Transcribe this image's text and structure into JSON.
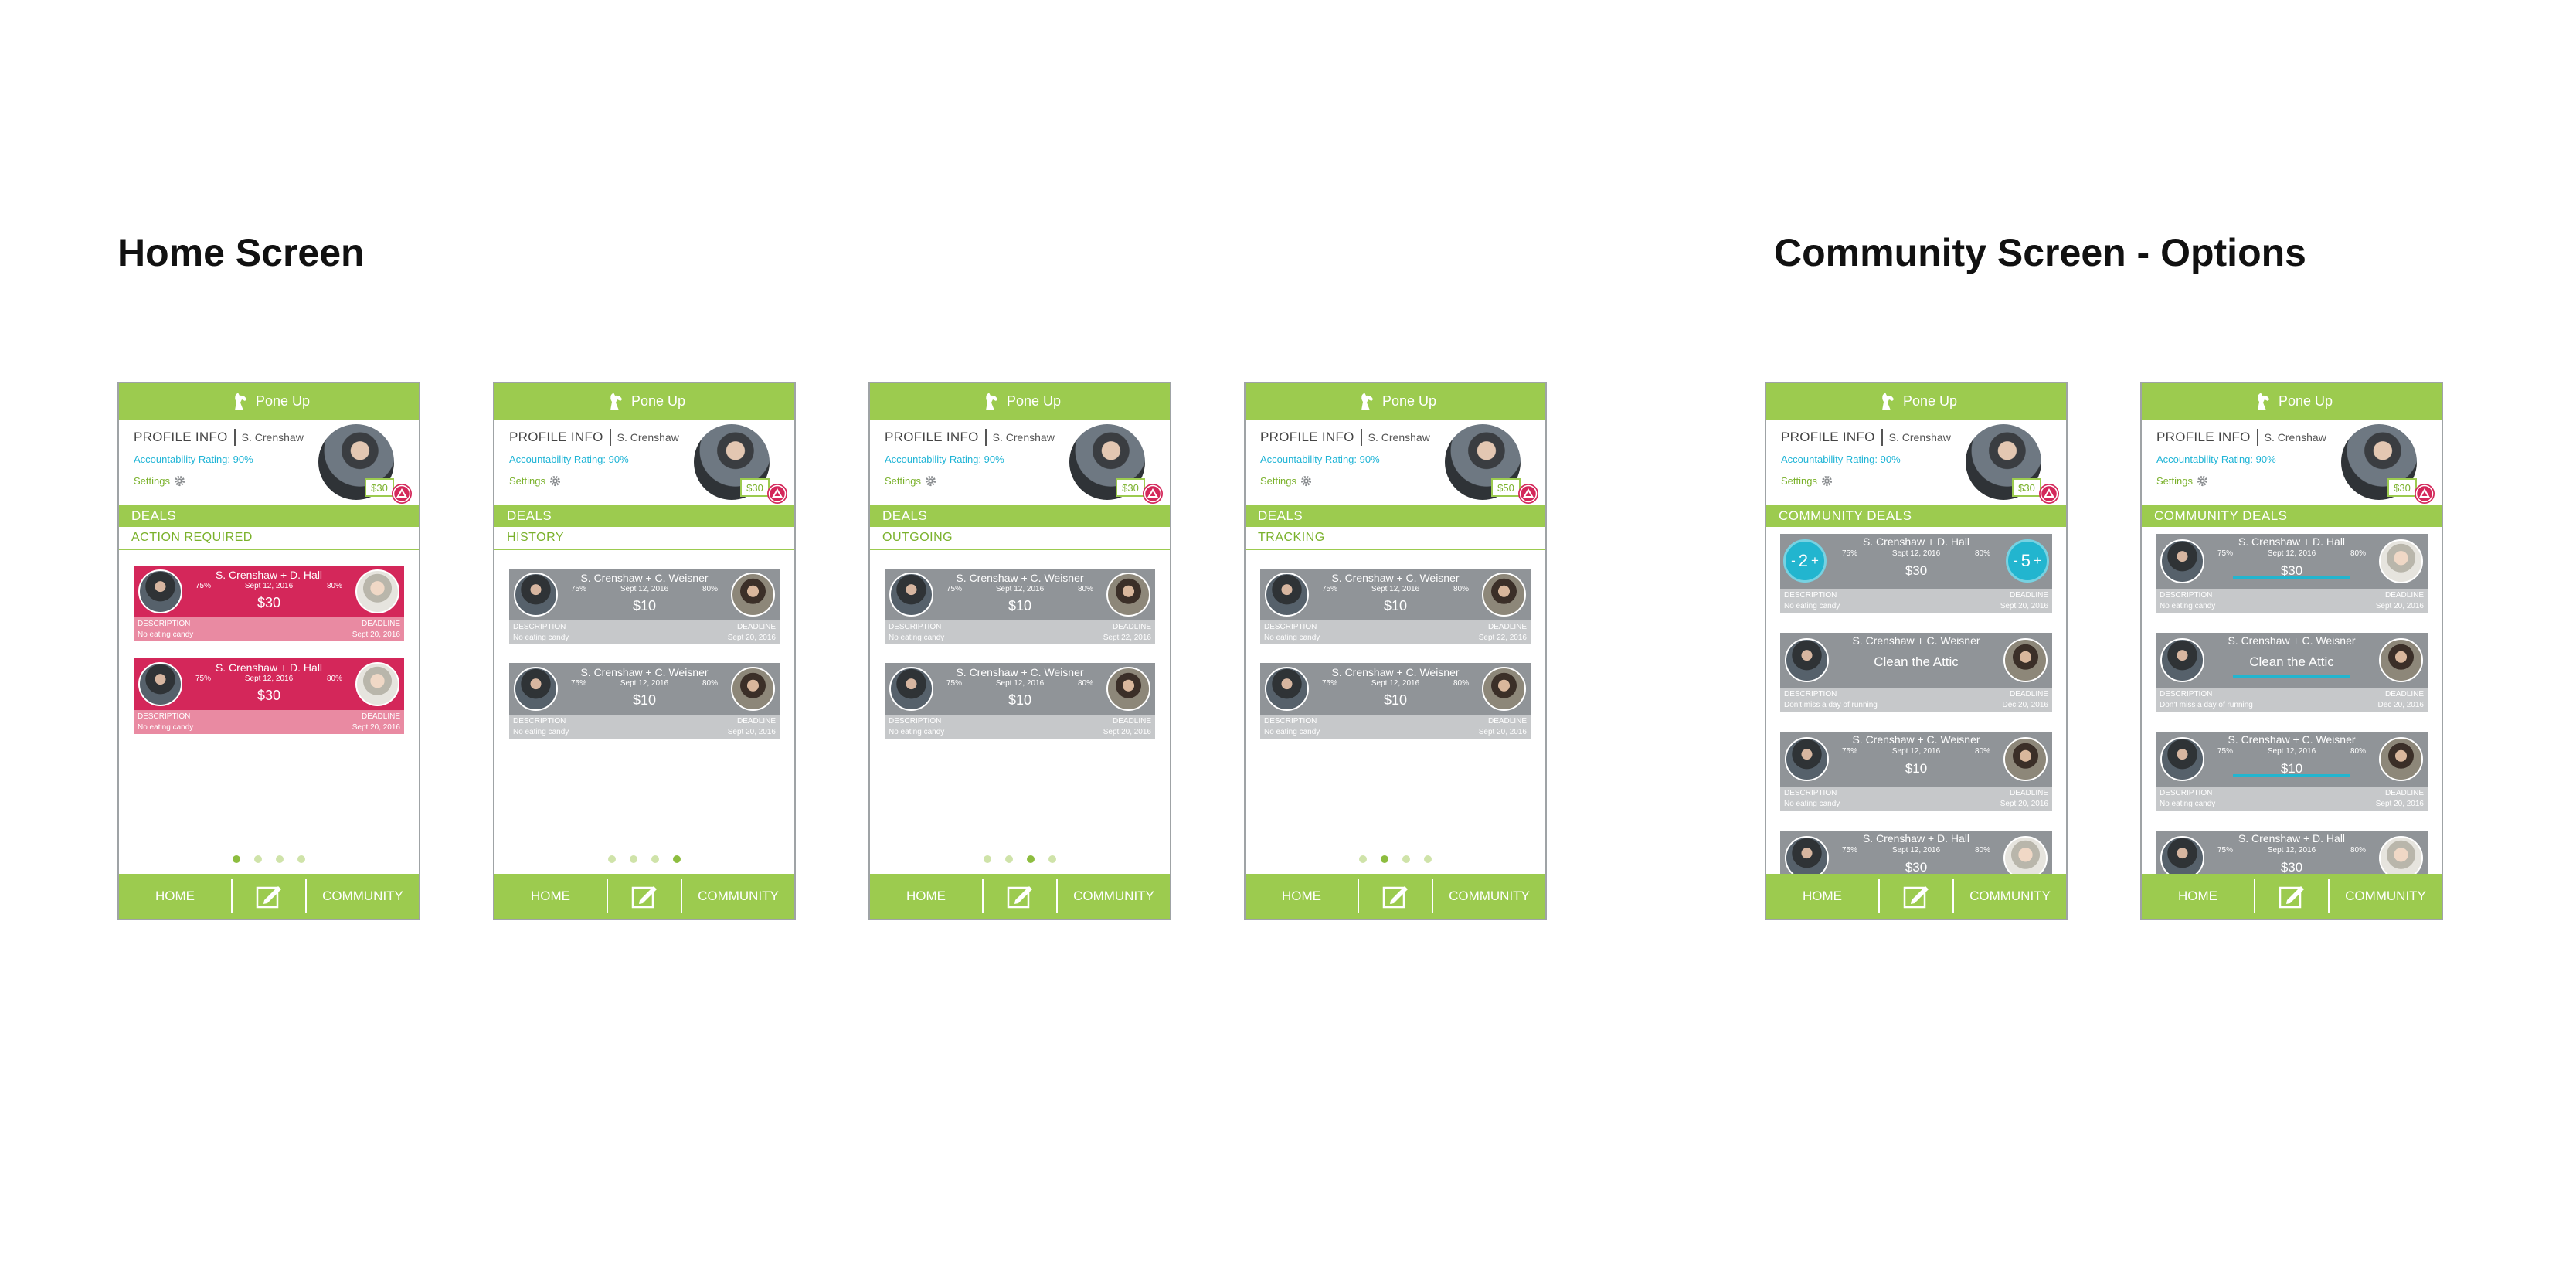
{
  "sections": {
    "home_title": "Home Screen",
    "community_title": "Community Screen - Options"
  },
  "app": {
    "name": "Pone Up",
    "profile_label": "PROFILE INFO",
    "user_name": "S. Crenshaw",
    "rating": "Accountability Rating: 90%",
    "settings": "Settings",
    "wallet": "$30",
    "deals": "DEALS",
    "community_deals": "COMMUNITY DEALS",
    "nav": {
      "home": "HOME",
      "community": "COMMUNITY"
    },
    "desc_label": "DESCRIPTION",
    "deadline_label": "DEADLINE"
  },
  "home_screens": [
    {
      "subheader": "ACTION REQUIRED",
      "theme": "red",
      "active_dot": 0,
      "cards": [
        {
          "names": "S. Crenshaw + D. Hall",
          "pct_a": "75%",
          "date": "Sept 12, 2016",
          "pct_b": "80%",
          "amount": "$30",
          "description": "No eating candy",
          "deadline": "Sept 20, 2016"
        },
        {
          "names": "S. Crenshaw + D. Hall",
          "pct_a": "75%",
          "date": "Sept 12, 2016",
          "pct_b": "80%",
          "amount": "$30",
          "description": "No eating candy",
          "deadline": "Sept 20, 2016"
        }
      ]
    },
    {
      "subheader": "HISTORY",
      "theme": "gray",
      "active_dot": 3,
      "cards": [
        {
          "names": "S. Crenshaw + C. Weisner",
          "pct_a": "75%",
          "date": "Sept 12, 2016",
          "pct_b": "80%",
          "amount": "$10",
          "description": "No eating candy",
          "deadline": "Sept 20, 2016"
        },
        {
          "names": "S. Crenshaw + C. Weisner",
          "pct_a": "75%",
          "date": "Sept 12, 2016",
          "pct_b": "80%",
          "amount": "$10",
          "description": "No eating candy",
          "deadline": "Sept 20, 2016"
        }
      ]
    },
    {
      "subheader": "OUTGOING",
      "theme": "gray",
      "active_dot": 2,
      "cards": [
        {
          "names": "S. Crenshaw + C. Weisner",
          "pct_a": "75%",
          "date": "Sept 12, 2016",
          "pct_b": "80%",
          "amount": "$10",
          "description": "No eating candy",
          "deadline": "Sept 22, 2016"
        },
        {
          "names": "S. Crenshaw + C. Weisner",
          "pct_a": "75%",
          "date": "Sept 12, 2016",
          "pct_b": "80%",
          "amount": "$10",
          "description": "No eating candy",
          "deadline": "Sept 20, 2016"
        }
      ]
    },
    {
      "subheader": "TRACKING",
      "theme": "gray",
      "active_dot": 1,
      "wallet": "$50",
      "cards": [
        {
          "names": "S. Crenshaw + C. Weisner",
          "pct_a": "75%",
          "date": "Sept 12, 2016",
          "pct_b": "80%",
          "amount": "$10",
          "description": "No eating candy",
          "deadline": "Sept 22, 2016"
        },
        {
          "names": "S. Crenshaw + C. Weisner",
          "pct_a": "75%",
          "date": "Sept 12, 2016",
          "pct_b": "80%",
          "amount": "$10",
          "description": "No eating candy",
          "deadline": "Sept 20, 2016"
        }
      ]
    }
  ],
  "community_screens": [
    {
      "variant": "votes",
      "vote_left": {
        "minus": "-",
        "value": "2",
        "plus": "+"
      },
      "vote_right": {
        "minus": "-",
        "value": "5",
        "plus": "+"
      },
      "cards": [
        {
          "names": "S. Crenshaw + D. Hall",
          "pct_a": "75%",
          "date": "Sept 12, 2016",
          "pct_b": "80%",
          "amount": "$30",
          "description": "No eating candy",
          "deadline": "Sept 20, 2016",
          "partner": "b"
        },
        {
          "names": "S. Crenshaw + C. Weisner",
          "pct_a": "",
          "date": "",
          "pct_b": "",
          "amount": "Clean the Attic",
          "description": "Don't miss a day of running",
          "deadline": "Dec 20, 2016",
          "partner": "c"
        },
        {
          "names": "S. Crenshaw + C. Weisner",
          "pct_a": "75%",
          "date": "Sept 12, 2016",
          "pct_b": "80%",
          "amount": "$10",
          "description": "No eating candy",
          "deadline": "Sept 20, 2016",
          "partner": "c"
        },
        {
          "names": "S. Crenshaw + D. Hall",
          "pct_a": "75%",
          "date": "Sept 12, 2016",
          "pct_b": "80%",
          "amount": "$30",
          "description": "",
          "deadline": "",
          "partner": "b"
        }
      ]
    },
    {
      "variant": "tracks",
      "cards": [
        {
          "names": "S. Crenshaw + D. Hall",
          "pct_a": "75%",
          "date": "Sept 12, 2016",
          "pct_b": "80%",
          "amount": "$30",
          "description": "No eating candy",
          "deadline": "Sept 20, 2016",
          "partner": "b"
        },
        {
          "names": "S. Crenshaw + C. Weisner",
          "pct_a": "",
          "date": "",
          "pct_b": "",
          "amount": "Clean the Attic",
          "description": "Don't miss a day of running",
          "deadline": "Dec 20, 2016",
          "partner": "c"
        },
        {
          "names": "S. Crenshaw + C. Weisner",
          "pct_a": "75%",
          "date": "Sept 12, 2016",
          "pct_b": "80%",
          "amount": "$10",
          "description": "No eating candy",
          "deadline": "Sept 20, 2016",
          "partner": "c"
        },
        {
          "names": "S. Crenshaw + D. Hall",
          "pct_a": "75%",
          "date": "Sept 12, 2016",
          "pct_b": "80%",
          "amount": "$30",
          "description": "",
          "deadline": "",
          "partner": "b"
        }
      ]
    }
  ],
  "colors": {
    "green": "#9ccb4f",
    "red": "#d4275a",
    "gray": "#909498",
    "cyan": "#1fb4d6"
  }
}
